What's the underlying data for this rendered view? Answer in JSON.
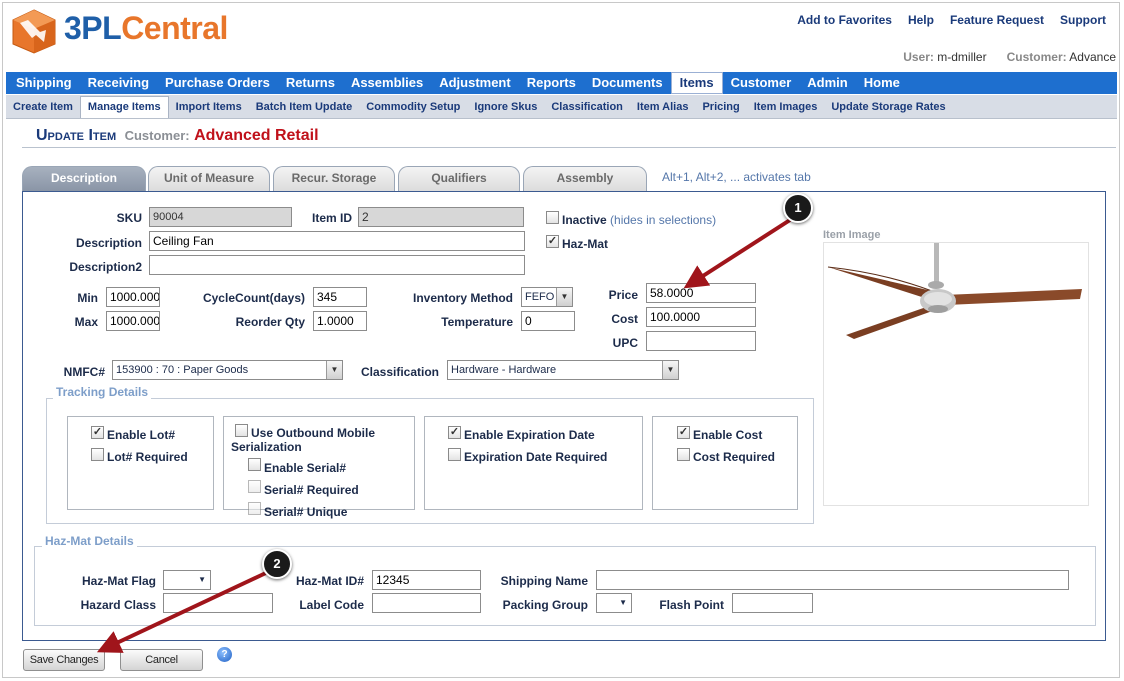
{
  "header": {
    "logo_part1": "3PL",
    "logo_part2": "Central",
    "links": [
      "Add to Favorites",
      "Help",
      "Feature Request",
      "Support"
    ],
    "user_label": "User:",
    "user_value": "m-dmiller",
    "customer_label": "Customer:",
    "customer_value": "Advance"
  },
  "mainnav": [
    "Shipping",
    "Receiving",
    "Purchase Orders",
    "Returns",
    "Assemblies",
    "Adjustment",
    "Reports",
    "Documents",
    "Items",
    "Customer",
    "Admin",
    "Home"
  ],
  "mainnav_active": "Items",
  "subnav": [
    "Create Item",
    "Manage Items",
    "Import Items",
    "Batch Item Update",
    "Commodity Setup",
    "Ignore Skus",
    "Classification",
    "Item Alias",
    "Pricing",
    "Item Images",
    "Update Storage Rates"
  ],
  "subnav_active": "Manage Items",
  "page": {
    "title": "Update Item",
    "customer_label": "Customer:",
    "customer_value": "Advanced Retail"
  },
  "tabs": [
    "Description",
    "Unit of Measure",
    "Recur. Storage",
    "Qualifiers",
    "Assembly"
  ],
  "tab_hint": "Alt+1, Alt+2, ... activates tab",
  "form": {
    "sku_label": "SKU",
    "sku_value": "90004",
    "item_id_label": "Item ID",
    "item_id_value": "2",
    "description_label": "Description",
    "description_value": "Ceiling Fan",
    "description2_label": "Description2",
    "description2_value": "",
    "inactive_label": "Inactive",
    "inactive_hint": "(hides in selections)",
    "inactive_checked": false,
    "hazmat_label": "Haz-Mat",
    "hazmat_checked": true,
    "min_label": "Min",
    "min_value": "1000.000",
    "max_label": "Max",
    "max_value": "1000.000",
    "cyclecount_label": "CycleCount(days)",
    "cyclecount_value": "345",
    "reorder_label": "Reorder Qty",
    "reorder_value": "1.0000",
    "inv_method_label": "Inventory Method",
    "inv_method_value": "FEFO",
    "temperature_label": "Temperature",
    "temperature_value": "0",
    "price_label": "Price",
    "price_value": "58.0000",
    "cost_label": "Cost",
    "cost_value": "100.0000",
    "upc_label": "UPC",
    "upc_value": "",
    "nmfc_label": "NMFC#",
    "nmfc_value": "153900 : 70 : Paper Goods",
    "classification_label": "Classification",
    "classification_value": "Hardware - Hardware"
  },
  "image": {
    "label": "Item Image"
  },
  "tracking": {
    "legend": "Tracking Details",
    "enable_lot": "Enable Lot#",
    "enable_lot_checked": true,
    "lot_required": "Lot# Required",
    "lot_required_checked": false,
    "use_outbound_line1": "Use Outbound Mobile",
    "use_outbound_line2": "Serialization",
    "use_outbound_checked": false,
    "enable_serial": "Enable Serial#",
    "serial_required": "Serial# Required",
    "serial_unique": "Serial# Unique",
    "enable_expiration": "Enable Expiration Date",
    "enable_expiration_checked": true,
    "expiration_required": "Expiration Date Required",
    "expiration_required_checked": false,
    "enable_cost": "Enable Cost",
    "enable_cost_checked": true,
    "cost_required": "Cost Required",
    "cost_required_checked": false
  },
  "hazmat": {
    "legend": "Haz-Mat Details",
    "flag_label": "Haz-Mat Flag",
    "flag_value": "",
    "id_label": "Haz-Mat ID#",
    "id_value": "12345",
    "shipping_name_label": "Shipping Name",
    "shipping_name_value": "",
    "hazard_class_label": "Hazard Class",
    "hazard_class_value": "",
    "label_code_label": "Label Code",
    "label_code_value": "",
    "packing_group_label": "Packing Group",
    "packing_group_value": "",
    "flash_point_label": "Flash Point",
    "flash_point_value": ""
  },
  "buttons": {
    "save": "Save Changes",
    "cancel": "Cancel",
    "help": "?"
  },
  "callouts": [
    "1",
    "2"
  ],
  "colors": {
    "nav_blue": "#1e6fcf",
    "customer_red": "#c0111a",
    "legend_blue": "#7d9ec9",
    "arrow": "#a0151b"
  },
  "icons": [
    "logo-cube-icon",
    "chevron-down-icon",
    "checkbox-icon",
    "help-icon",
    "ceiling-fan-image"
  ]
}
